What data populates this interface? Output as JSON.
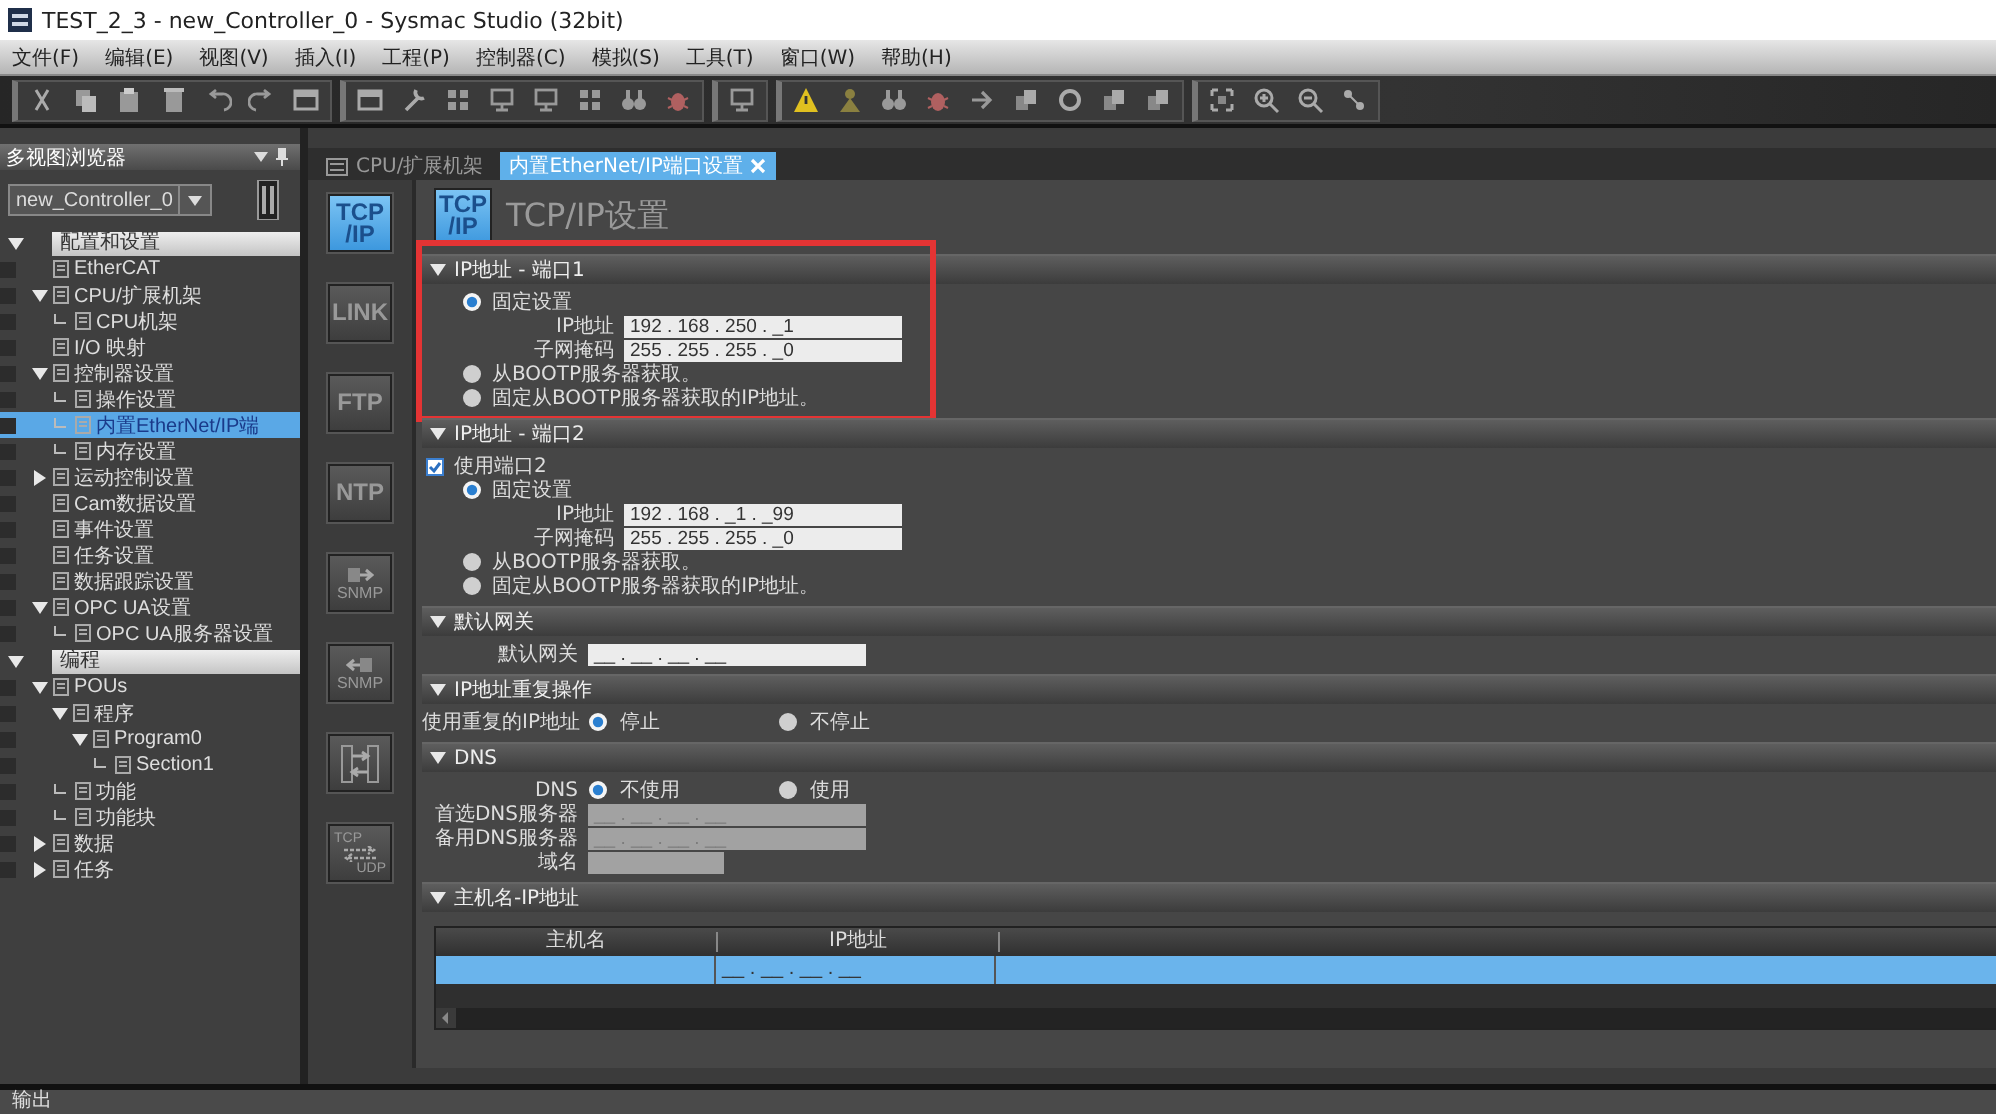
{
  "window": {
    "title": "TEST_2_3 - new_Controller_0 - Sysmac Studio (32bit)"
  },
  "menu": [
    "文件(F)",
    "编辑(E)",
    "视图(V)",
    "插入(I)",
    "工程(P)",
    "控制器(C)",
    "模拟(S)",
    "工具(T)",
    "窗口(W)",
    "帮助(H)"
  ],
  "sidebar": {
    "title": "多视图浏览器",
    "controller": "new_Controller_0",
    "tree": [
      {
        "label": "配置和设置",
        "expanded": true,
        "selected": false,
        "children": [
          {
            "label": "EtherCAT",
            "selected": false
          },
          {
            "label": "CPU/扩展机架",
            "expanded": true,
            "selected": false,
            "children": [
              {
                "label": "CPU机架",
                "selected": false
              }
            ]
          },
          {
            "label": "I/O 映射",
            "selected": false
          },
          {
            "label": "控制器设置",
            "expanded": true,
            "selected": false,
            "children": [
              {
                "label": "操作设置",
                "selected": false
              },
              {
                "label": "内置EtherNet/IP端",
                "selected": true
              },
              {
                "label": "内存设置",
                "selected": false
              }
            ]
          },
          {
            "label": "运动控制设置",
            "expanded": false,
            "selected": false
          },
          {
            "label": "Cam数据设置",
            "selected": false
          },
          {
            "label": "事件设置",
            "selected": false
          },
          {
            "label": "任务设置",
            "selected": false
          },
          {
            "label": "数据跟踪设置",
            "selected": false
          },
          {
            "label": "OPC UA设置",
            "expanded": true,
            "selected": false,
            "children": [
              {
                "label": "OPC UA服务器设置",
                "selected": false
              }
            ]
          }
        ]
      },
      {
        "label": "编程",
        "expanded": true,
        "selected": false,
        "children": [
          {
            "label": "POUs",
            "expanded": true,
            "selected": false,
            "children": [
              {
                "label": "程序",
                "expanded": true,
                "selected": false,
                "children": [
                  {
                    "label": "Program0",
                    "expanded": true,
                    "selected": false,
                    "children": [
                      {
                        "label": "Section1",
                        "selected": false
                      }
                    ]
                  }
                ]
              },
              {
                "label": "功能",
                "selected": false
              },
              {
                "label": "功能块",
                "selected": false
              }
            ]
          },
          {
            "label": "数据",
            "expanded": false,
            "selected": false
          },
          {
            "label": "任务",
            "expanded": false,
            "selected": false
          }
        ]
      }
    ]
  },
  "tabs": [
    {
      "label": "CPU/扩展机架",
      "selected": false
    },
    {
      "label": "内置EtherNet/IP端口设置",
      "selected": true
    }
  ],
  "categories": [
    {
      "kind": "text",
      "label": "TCP\n/IP",
      "selected": true
    },
    {
      "kind": "text",
      "label": "LINK",
      "selected": false
    },
    {
      "kind": "text",
      "label": "FTP",
      "selected": false
    },
    {
      "kind": "text",
      "label": "NTP",
      "selected": false
    },
    {
      "kind": "snmp-out",
      "label": "SNMP",
      "selected": false
    },
    {
      "kind": "snmp-in",
      "label": "SNMP",
      "selected": false
    },
    {
      "kind": "route",
      "selected": false
    },
    {
      "kind": "tcp-udp",
      "labels": [
        "TCP",
        "UDP"
      ],
      "selected": false
    }
  ],
  "page": {
    "badge": "TCP\n/IP",
    "title": "TCP/IP设置"
  },
  "sections": [
    {
      "title": "IP地址 - 端口1",
      "expanded": true,
      "highlighted": true,
      "rows": [
        {
          "kind": "radio",
          "label": "固定设置",
          "selected": true
        },
        {
          "kind": "field",
          "label": "IP地址",
          "value": "192 . 168 . 250 . _1",
          "disabled": false
        },
        {
          "kind": "field",
          "label": "子网掩码",
          "value": "255 . 255 . 255 . _0",
          "disabled": false
        },
        {
          "kind": "radio",
          "label": "从BOOTP服务器获取。",
          "selected": false
        },
        {
          "kind": "radio",
          "label": "固定从BOOTP服务器获取的IP地址。",
          "selected": false
        }
      ]
    },
    {
      "title": "IP地址 - 端口2",
      "expanded": true,
      "highlighted": false,
      "rows": [
        {
          "kind": "checkbox",
          "label": "使用端口2",
          "checked": true
        },
        {
          "kind": "radio",
          "label": "固定设置",
          "selected": true
        },
        {
          "kind": "field",
          "label": "IP地址",
          "value": "192 . 168 . _1 . _99",
          "disabled": false
        },
        {
          "kind": "field",
          "label": "子网掩码",
          "value": "255 . 255 . 255 . _0",
          "disabled": false
        },
        {
          "kind": "radio",
          "label": "从BOOTP服务器获取。",
          "selected": false
        },
        {
          "kind": "radio",
          "label": "固定从BOOTP服务器获取的IP地址。",
          "selected": false
        }
      ]
    },
    {
      "title": "默认网关",
      "expanded": true,
      "highlighted": false,
      "rows": [
        {
          "kind": "field",
          "label": "默认网关",
          "value": "__ . __ . __ . __",
          "disabled": false
        }
      ]
    },
    {
      "title": "IP地址重复操作",
      "expanded": true,
      "highlighted": false,
      "rows": [
        {
          "kind": "choice",
          "label": "使用重复的IP地址",
          "options": [
            {
              "label": "停止",
              "selected": true
            },
            {
              "label": "不停止",
              "selected": false
            }
          ]
        }
      ]
    },
    {
      "title": "DNS",
      "expanded": true,
      "highlighted": false,
      "rows": [
        {
          "kind": "choice",
          "label": "DNS",
          "options": [
            {
              "label": "不使用",
              "selected": true
            },
            {
              "label": "使用",
              "selected": false
            }
          ]
        },
        {
          "kind": "field",
          "label": "首选DNS服务器",
          "placeholder": "__ . __ . __ . __",
          "disabled": true
        },
        {
          "kind": "field",
          "label": "备用DNS服务器",
          "placeholder": "__ . __ . __ . __",
          "disabled": true
        },
        {
          "kind": "short-field",
          "label": "域名",
          "disabled": true
        }
      ]
    },
    {
      "title": "主机名-IP地址",
      "expanded": true,
      "highlighted": false,
      "rows": [
        {
          "kind": "table",
          "columns": [
            "主机名",
            "IP地址"
          ],
          "rows": [
            {
              "ip_address": "__ . __ . __ . __",
              "selected": true
            }
          ]
        }
      ]
    }
  ],
  "output": {
    "title": "输出"
  }
}
